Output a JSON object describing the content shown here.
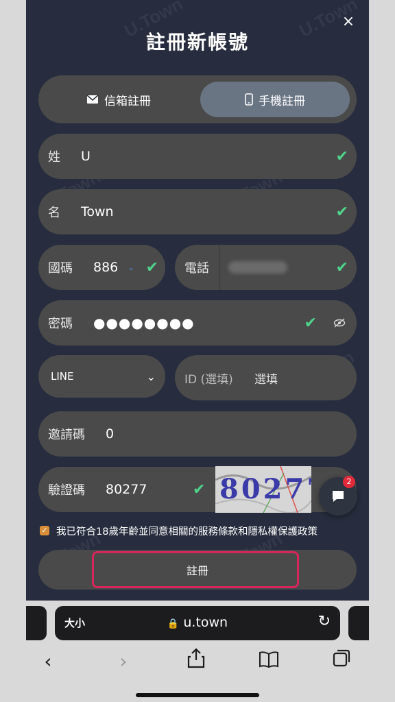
{
  "modal": {
    "title": "註冊新帳號",
    "close_icon": "×",
    "watermark": "U.Town"
  },
  "tabs": {
    "email": {
      "label": "信箱註冊",
      "icon": "email-icon"
    },
    "phone": {
      "label": "手機註冊",
      "icon": "phone-icon",
      "active": true
    }
  },
  "form": {
    "surname": {
      "label": "姓",
      "value": "U"
    },
    "given_name": {
      "label": "名",
      "value": "Town"
    },
    "country_code": {
      "label": "國碼",
      "value": "886"
    },
    "phone": {
      "label": "電話"
    },
    "password": {
      "label": "密碼",
      "value": "●●●●●●●●"
    },
    "contact_type": {
      "value": "LINE"
    },
    "contact_id": {
      "label": "ID (選填)",
      "placeholder": "選填"
    },
    "invite_code": {
      "label": "邀請碼",
      "value": "0"
    },
    "captcha": {
      "label": "驗證碼",
      "value": "80277",
      "image_text": "80277"
    }
  },
  "agreement": {
    "checked": true,
    "text": "我已符合18歲年齡並同意相關的服務條款和隱私權保護政策"
  },
  "submit": {
    "label": "註冊"
  },
  "chat": {
    "badge": "2"
  },
  "browser": {
    "text_size": "大小",
    "url": "u.town"
  },
  "colors": {
    "accent_check": "#4fd38a",
    "highlight": "#d7265b",
    "badge": "#e02a3a"
  }
}
